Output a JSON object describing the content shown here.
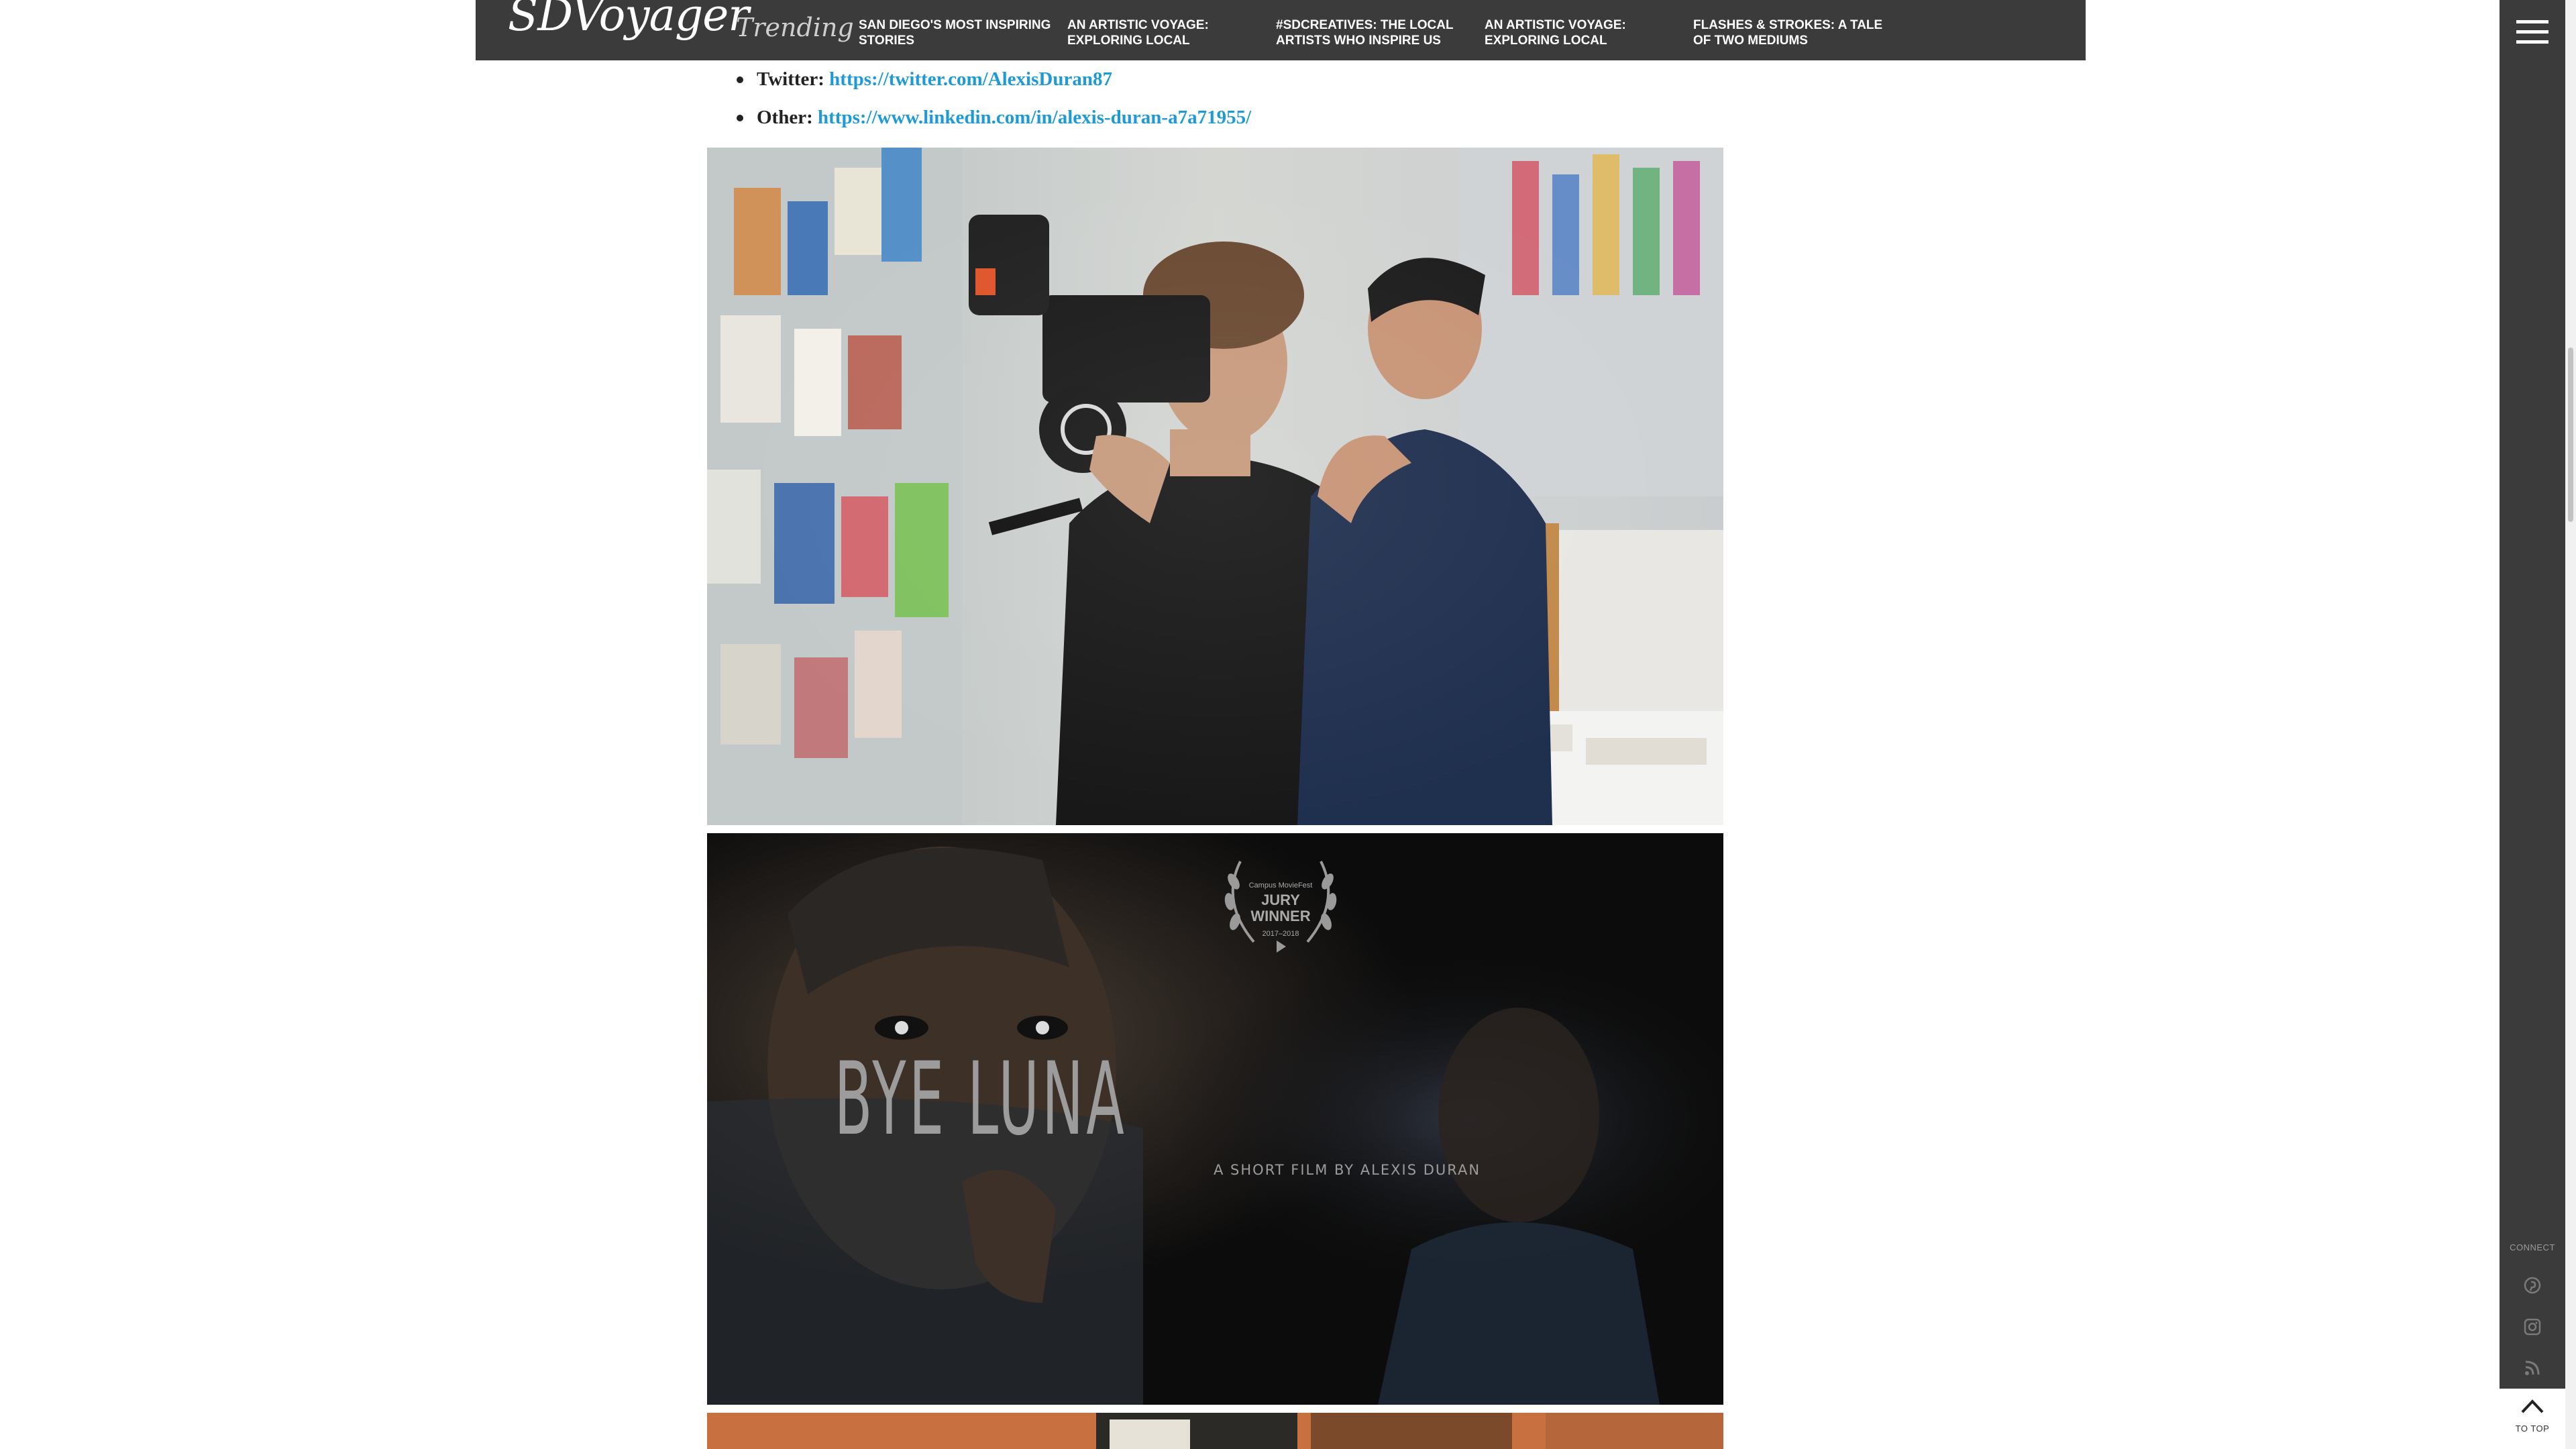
{
  "header": {
    "logo": "SDVoyager",
    "trending_label": "Trending",
    "trending": [
      {
        "label": "SAN DIEGO'S MOST INSPIRING STORIES"
      },
      {
        "label": "AN ARTISTIC VOYAGE: EXPLORING LOCAL"
      },
      {
        "label": "#SDCREATIVES: THE LOCAL ARTISTS WHO INSPIRE US"
      },
      {
        "label": "AN ARTISTIC VOYAGE: EXPLORING LOCAL"
      },
      {
        "label": "FLASHES & STROKES: A TALE OF TWO MEDIUMS"
      }
    ]
  },
  "sidebar": {
    "connect_label": "CONNECT",
    "icons": [
      "pinterest-icon",
      "instagram-icon",
      "rss-icon"
    ],
    "to_top_label": "TO TOP"
  },
  "article": {
    "links": [
      {
        "label": "Twitter:",
        "url": "https://twitter.com/AlexisDuran87"
      },
      {
        "label": "Other:",
        "url": "https://www.linkedin.com/in/alexis-duran-a7a71955/"
      }
    ],
    "poster": {
      "laurel_top": "Campus MovieFest",
      "laurel_main": "JURY WINNER",
      "laurel_year": "2017–2018",
      "title": "BYE LUNA",
      "subtitle": "A SHORT FILM BY ALEXIS DURAN"
    }
  },
  "colors": {
    "topbar": "#3b3b3b",
    "sidebar": "#3b3b3b",
    "link": "#1e9bd7",
    "body_text": "#222222"
  }
}
